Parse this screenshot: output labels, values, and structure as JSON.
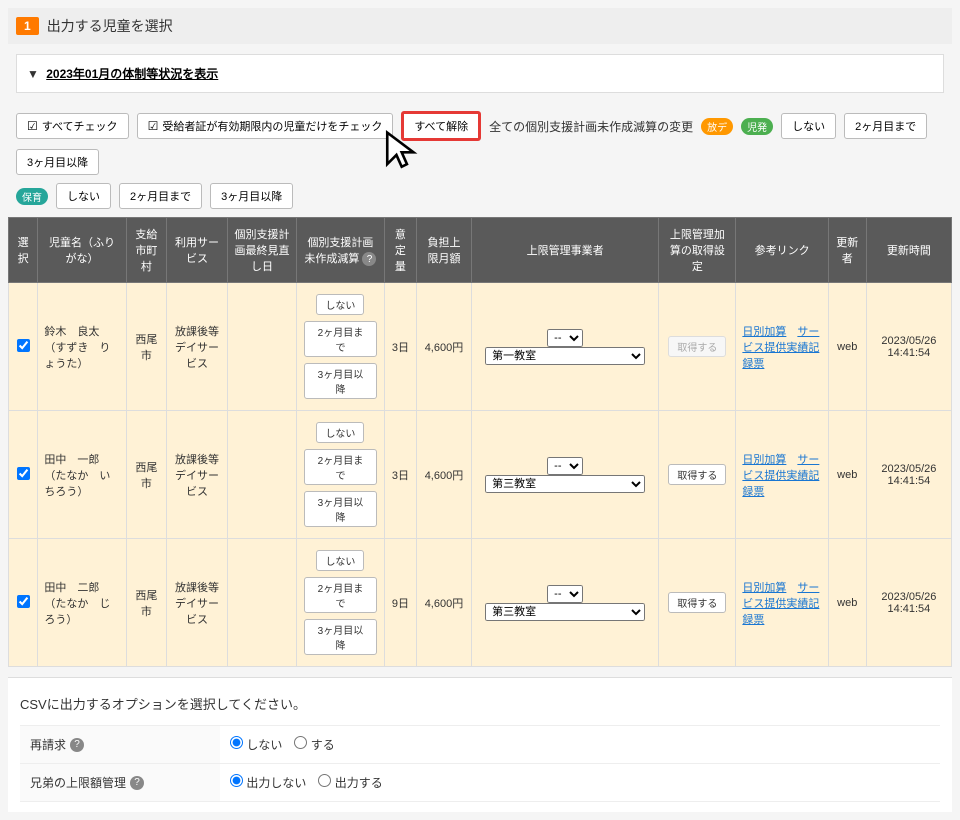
{
  "section": {
    "step": "1",
    "title": "出力する児童を選択"
  },
  "status_link": "2023年01月の体制等状況を表示",
  "toolbar": {
    "check_all": "すべてチェック",
    "check_valid": "受給者証が有効期限内の児童だけをチェック",
    "uncheck_all": "すべて解除",
    "global_label": "全ての個別支援計画未作成減算の変更",
    "pill_after": "放デ",
    "pill_dev": "児発",
    "none": "しない",
    "until2": "2ヶ月目まで",
    "after3": "3ヶ月目以降",
    "pill_nursery": "保育"
  },
  "table": {
    "headers": {
      "select": "選択",
      "name": "児童名（ふりがな）",
      "city": "支給市町村",
      "service": "利用サービス",
      "last_review": "個別支援計画最終見直し日",
      "plan_reduction": "個別支援計画未作成減算",
      "amount": "意定量",
      "monthly_cap": "負担上限月額",
      "cap_manager": "上限管理事業者",
      "cap_setting": "上限管理加算の取得設定",
      "links": "参考リンク",
      "updater": "更新者",
      "updated_at": "更新時間"
    },
    "link_labels": {
      "daily": "日別加算",
      "service": "サービス提供実績記録票"
    },
    "plan_buttons": {
      "none": "しない",
      "until2": "2ヶ月目まで",
      "after3": "3ヶ月目以降"
    },
    "cap_btn": {
      "get": "取得する",
      "disabled": "取得する"
    },
    "dash_option": "--",
    "rows": [
      {
        "name": "鈴木　良太（すずき　りょうた）",
        "city": "西尾市",
        "service": "放課後等デイサービス",
        "amount": "3日",
        "cap": "4,600円",
        "manager": "第一教室",
        "cap_enabled": false,
        "updater": "web",
        "updated_at": "2023/05/26 14:41:54"
      },
      {
        "name": "田中　一郎（たなか　いちろう）",
        "city": "西尾市",
        "service": "放課後等デイサービス",
        "amount": "3日",
        "cap": "4,600円",
        "manager": "第三教室",
        "cap_enabled": true,
        "updater": "web",
        "updated_at": "2023/05/26 14:41:54"
      },
      {
        "name": "田中　二郎（たなか　じろう）",
        "city": "西尾市",
        "service": "放課後等デイサービス",
        "amount": "9日",
        "cap": "4,600円",
        "manager": "第三教室",
        "cap_enabled": true,
        "updater": "web",
        "updated_at": "2023/05/26 14:41:54"
      }
    ]
  },
  "csv": {
    "heading": "CSVに出力するオプションを選択してください。",
    "reclaim_label": "再請求",
    "reclaim_options": {
      "no": "しない",
      "yes": "する"
    },
    "sibling_label": "兄弟の上限額管理",
    "sibling_options": {
      "no": "出力しない",
      "yes": "出力する"
    }
  }
}
